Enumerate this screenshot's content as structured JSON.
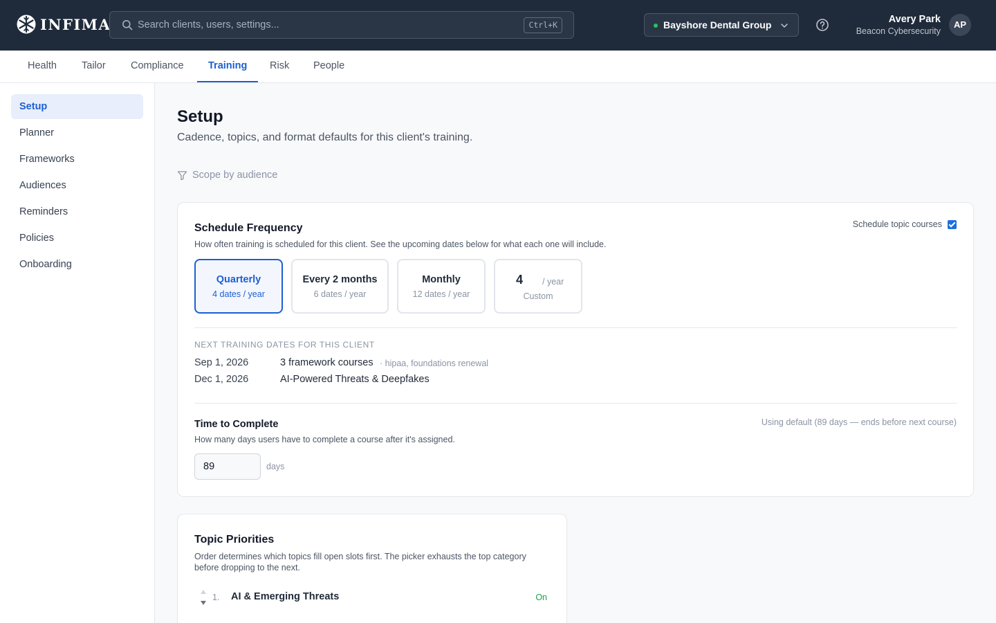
{
  "app": {
    "logo_text": "INFIMA",
    "search_placeholder": "Search clients, users, settings...",
    "search_shortcut": "Ctrl+K",
    "client_name": "Bayshore Dental Group",
    "user_name": "Avery Park",
    "user_org": "Beacon Cybersecurity",
    "user_initials": "AP"
  },
  "tabs": [
    {
      "label": "Health"
    },
    {
      "label": "Tailor"
    },
    {
      "label": "Compliance"
    },
    {
      "label": "Training",
      "active": true
    },
    {
      "label": "Risk"
    },
    {
      "label": "People"
    }
  ],
  "sidebar": {
    "items": [
      {
        "label": "Setup",
        "active": true
      },
      {
        "label": "Planner"
      },
      {
        "label": "Frameworks"
      },
      {
        "label": "Audiences"
      },
      {
        "label": "Reminders"
      },
      {
        "label": "Policies"
      },
      {
        "label": "Onboarding"
      }
    ]
  },
  "page": {
    "title": "Setup",
    "subtitle": "Cadence, topics, and format defaults for this client's training.",
    "scope_label": "Scope by audience"
  },
  "schedule": {
    "title": "Schedule Frequency",
    "description": "How often training is scheduled for this client. See the upcoming dates below for what each one will include.",
    "toggle_label": "Schedule topic courses",
    "toggle_checked": true,
    "options": [
      {
        "label": "Quarterly",
        "sub": "4 dates / year",
        "active": true
      },
      {
        "label": "Every 2 months",
        "sub": "6 dates / year"
      },
      {
        "label": "Monthly",
        "sub": "12 dates / year"
      }
    ],
    "custom": {
      "value": "4",
      "unit": "/ year",
      "label": "Custom"
    },
    "dates_heading": "NEXT TRAINING DATES FOR THIS CLIENT",
    "dates": [
      {
        "date": "Sep 1, 2026",
        "content": "3 framework courses",
        "meta": "· hipaa, foundations renewal"
      },
      {
        "date": "Dec 1, 2026",
        "content": "AI-Powered Threats & Deepfakes",
        "meta": ""
      }
    ]
  },
  "time_to_complete": {
    "title": "Time to Complete",
    "description": "How many days users have to complete a course after it's assigned.",
    "note": "Using default (89 days — ends before next course)",
    "value": "89",
    "unit": "days"
  },
  "topic_priorities": {
    "title": "Topic Priorities",
    "description": "Order determines which topics fill open slots first. The picker exhausts the top category before dropping to the next.",
    "items": [
      {
        "rank": "1.",
        "name": "AI & Emerging Threats",
        "status": "On"
      }
    ]
  },
  "colors": {
    "accent": "#1d5fd1",
    "topbar": "#1f2a3a",
    "status_on": "#16a34a",
    "status_dot": "#22c55e"
  }
}
